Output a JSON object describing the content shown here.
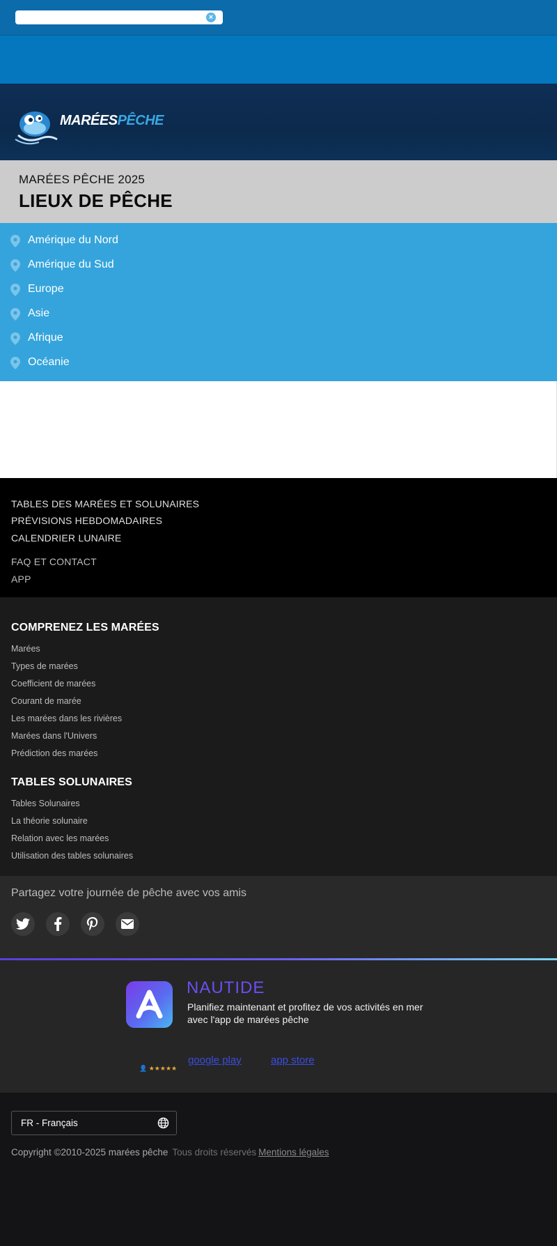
{
  "search": {
    "value": "",
    "placeholder": ""
  },
  "header": {
    "logo_word1": "MARÉES",
    "logo_word2": "PÊCHE",
    "subtitle": "MARÉES PÊCHE 2025",
    "title": "LIEUX DE PÊCHE"
  },
  "regions": [
    {
      "label": "Amérique du Nord"
    },
    {
      "label": "Amérique du Sud"
    },
    {
      "label": "Europe"
    },
    {
      "label": "Asie"
    },
    {
      "label": "Afrique"
    },
    {
      "label": "Océanie"
    }
  ],
  "nav": {
    "tides_tables": "TABLES DES MARÉES ET SOLUNAIRES",
    "weekly_forecast": "PRÉVISIONS HEBDOMADAIRES",
    "lunar_calendar": "CALENDRIER LUNAIRE",
    "faq_contact": "FAQ ET CONTACT",
    "app": "APP"
  },
  "understand": {
    "heading": "COMPRENEZ LES MARÉES",
    "links": [
      "Marées",
      "Types de marées",
      "Coefficient de marées",
      "Courant de marée",
      "Les marées dans les rivières",
      "Marées dans l'Univers",
      "Prédiction des marées"
    ]
  },
  "solunar": {
    "heading": "TABLES SOLUNAIRES",
    "links": [
      "Tables Solunaires",
      "La théorie solunaire",
      "Relation avec les marées",
      "Utilisation des tables solunaires"
    ]
  },
  "share": {
    "text": "Partagez votre journée de pêche avec vos amis",
    "icons": [
      "twitter-icon",
      "facebook-icon",
      "pinterest-icon",
      "email-icon"
    ]
  },
  "promo": {
    "app_name": "NAUTIDE",
    "description": "Planifiez maintenant et profitez de vos activités en mer avec l'app de marées pêche",
    "rating_stars": "★★★★★",
    "google_play": "google play",
    "app_store": "app store",
    "accent": "#6c4ef2"
  },
  "footer": {
    "language": "FR - Français",
    "copyright": "Copyright ©2010-2025 marées pêche",
    "rights": "Tous droits réservés",
    "legal": "Mentions légales"
  }
}
